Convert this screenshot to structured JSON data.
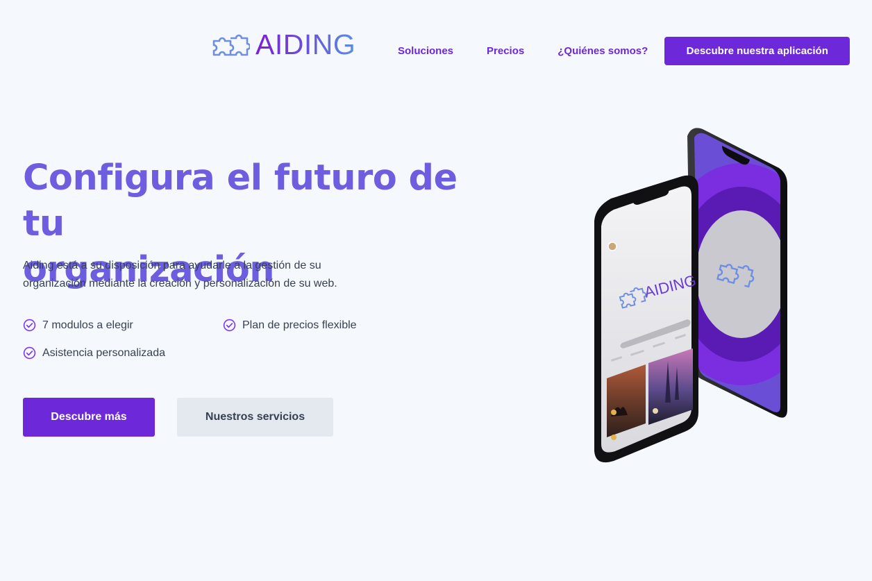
{
  "brand": {
    "name": "AIDING",
    "colors": {
      "primary": "#6d28d9",
      "heading": "#6d5ee0",
      "logo_gradient_start": "#7a1fd6",
      "logo_gradient_end": "#5b8fe0"
    }
  },
  "nav": {
    "links": [
      "Soluciones",
      "Precios",
      "¿Quiénes somos?"
    ],
    "cta": "Descubre nuestra aplicación"
  },
  "hero": {
    "title_line1": "Configura el futuro de tu",
    "title_line2": "organización",
    "subtitle_line1": "Aiding está a su disposición para ayudarle a la gestión de su",
    "subtitle_line2": "organización mediante la creación y personalización de su web.",
    "features": [
      "7 modulos a elegir",
      "Plan de precios flexible",
      "Asistencia personalizada"
    ],
    "primary_button": "Descubre más",
    "secondary_button": "Nuestros servicios"
  },
  "illustration": {
    "icon": "phone-mockup",
    "phone_logo": "AIDING"
  }
}
